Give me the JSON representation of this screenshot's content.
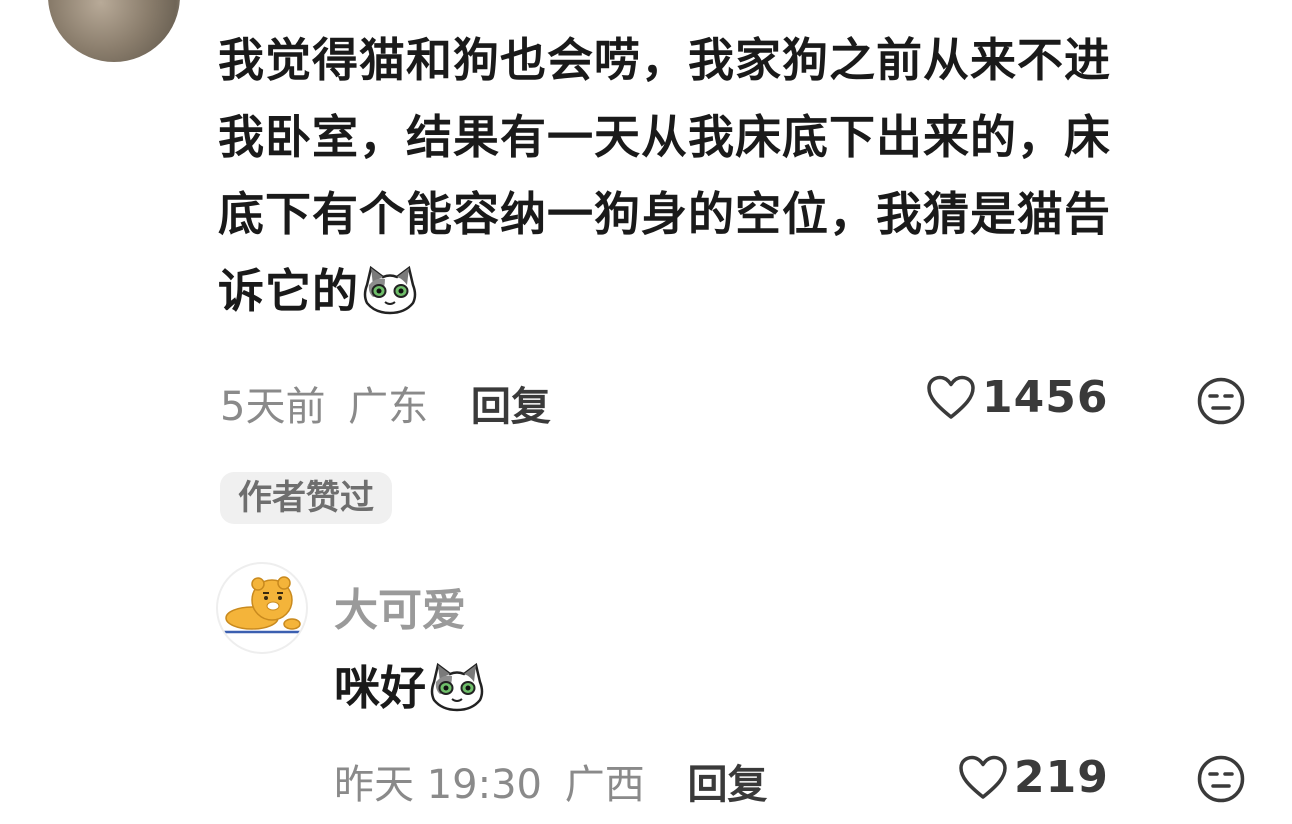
{
  "comment": {
    "text_line1": "我觉得猫和狗也会唠，我家狗之前从来不进",
    "text_line2": "我卧室，结果有一天从我床底下出来的，床",
    "text_line3": "底下有个能容纳一狗身的空位，我猜是猫告",
    "text_line4": "诉它的",
    "emoji": "cat-face-emoji",
    "time": "5天前",
    "location": "广东",
    "reply_label": "回复",
    "like_count": "1456",
    "author_liked_badge": "作者赞过"
  },
  "reply": {
    "username": "大可爱",
    "text": "咪好",
    "emoji": "cat-face-emoji",
    "time": "昨天 19:30",
    "location": "广西",
    "reply_label": "回复",
    "like_count": "219"
  },
  "colors": {
    "text_primary": "#1a1a1a",
    "text_secondary": "#8a8a8a",
    "badge_bg": "#f0f0f0",
    "avatar_accent": "#f4b43a"
  }
}
